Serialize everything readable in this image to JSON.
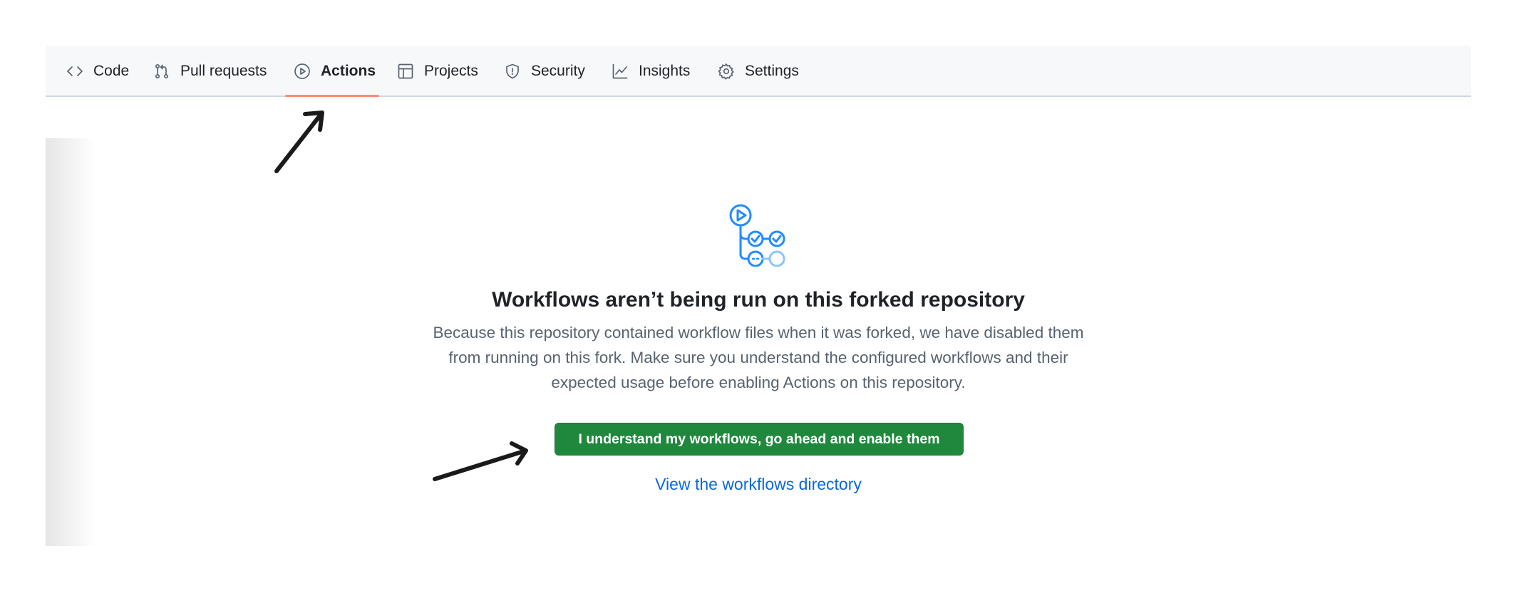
{
  "tabs": [
    {
      "label": "Code",
      "icon": "code-icon"
    },
    {
      "label": "Pull requests",
      "icon": "git-pull-request-icon"
    },
    {
      "label": "Actions",
      "icon": "play-icon",
      "active": true
    },
    {
      "label": "Projects",
      "icon": "table-icon"
    },
    {
      "label": "Security",
      "icon": "shield-icon"
    },
    {
      "label": "Insights",
      "icon": "graph-icon"
    },
    {
      "label": "Settings",
      "icon": "gear-icon"
    }
  ],
  "empty_state": {
    "icon": "workflow-icon",
    "title": "Workflows aren’t being run on this forked repository",
    "description_lines": [
      "Because this repository contained workflow files when it was forked, we have disabled them",
      "from running on this fork. Make sure you understand the configured workflows and their",
      "expected usage before enabling Actions on this repository."
    ],
    "enable_button": "I understand my workflows, go ahead and enable them",
    "directory_link": "View the workflows directory"
  },
  "colors": {
    "accent_underline": "#fd8c73",
    "primary_button": "#1f883d",
    "link": "#0969da",
    "workflow_icon": "#218bff"
  }
}
